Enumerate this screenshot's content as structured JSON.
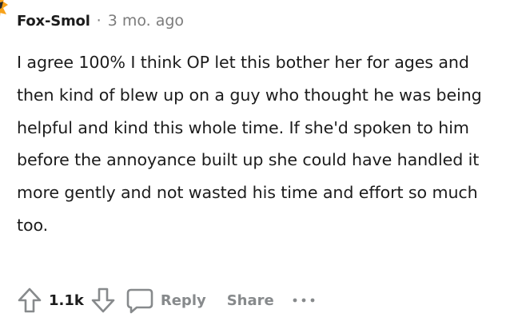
{
  "comment": {
    "author": "Fox-Smol",
    "separator": "·",
    "timestamp": "3 mo. ago",
    "body": "I agree 100% I think OP let this bother her for ages and then kind of blew up on a guy who thought he was being helpful and kind this whole time. If she'd spoken to him before the annoyance built up she could have handled it more gently and not wasted his time and effort so much too."
  },
  "actions": {
    "upvote_icon": "arrow-up-icon",
    "vote_count": "1.1k",
    "downvote_icon": "arrow-down-icon",
    "reply_icon": "speech-bubble-icon",
    "reply_label": "Reply",
    "share_label": "Share",
    "more_icon": "ellipsis-icon"
  },
  "colors": {
    "avatar_accent": "#f7a21b",
    "text": "#1c1c1c",
    "muted": "#7c7c7c",
    "action_gray": "#878a8c"
  }
}
